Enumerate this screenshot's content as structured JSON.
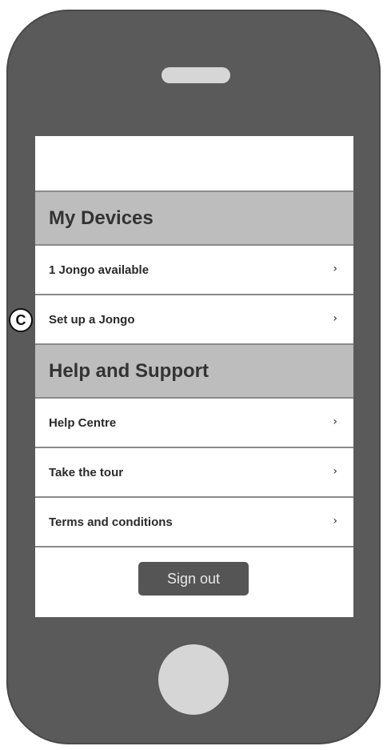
{
  "sections": {
    "devices": {
      "title": "My Devices",
      "items": [
        {
          "label": "1 Jongo available"
        },
        {
          "label": "Set up a Jongo"
        }
      ]
    },
    "help": {
      "title": "Help and Support",
      "items": [
        {
          "label": "Help Centre"
        },
        {
          "label": "Take the tour"
        },
        {
          "label": "Terms and conditions"
        }
      ]
    }
  },
  "chevron_glyph": "›",
  "sign_out_label": "Sign out",
  "annotation": {
    "label": "C"
  },
  "icons": {
    "chevron": "chevron-right-icon"
  },
  "colors": {
    "phone_body": "#5a5a5a",
    "section_header_bg": "#bdbdbd",
    "button_bg": "#555555",
    "hardware_accent": "#d6d6d6"
  }
}
